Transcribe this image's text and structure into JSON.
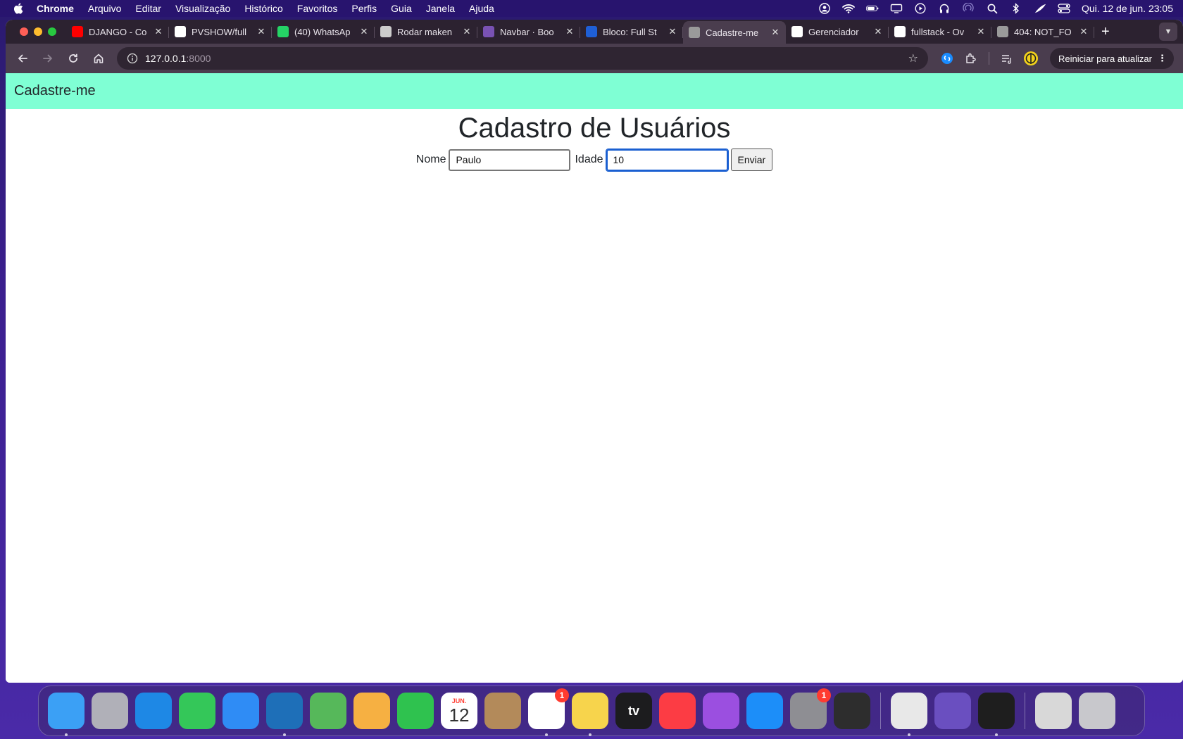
{
  "menubar": {
    "app_name": "Chrome",
    "items": [
      "Arquivo",
      "Editar",
      "Visualização",
      "Histórico",
      "Favoritos",
      "Perfis",
      "Guia",
      "Janela",
      "Ajuda"
    ],
    "clock": "Qui. 12 de jun.  23:05"
  },
  "tabs": [
    {
      "title": "DJANGO - Co",
      "icon": "youtube-icon",
      "color": "#ff0000"
    },
    {
      "title": "PVSHOW/full",
      "icon": "github-icon",
      "color": "#ffffff"
    },
    {
      "title": "(40) WhatsAp",
      "icon": "whatsapp-icon",
      "color": "#25d366"
    },
    {
      "title": "Rodar maken",
      "icon": "openai-icon",
      "color": "#cccccc"
    },
    {
      "title": "Navbar · Boo",
      "icon": "bootstrap-icon",
      "color": "#7952b3"
    },
    {
      "title": "Bloco: Full St",
      "icon": "bloco-icon",
      "color": "#1f5fd6"
    },
    {
      "title": "Cadastre-me",
      "icon": "globe-icon",
      "color": "#9a9a9a",
      "active": true
    },
    {
      "title": "Gerenciador",
      "icon": "password-manager-icon",
      "color": "#ffffff"
    },
    {
      "title": "fullstack - Ov",
      "icon": "vercel-icon",
      "color": "#ffffff"
    },
    {
      "title": "404: NOT_FO",
      "icon": "globe-icon",
      "color": "#9a9a9a"
    }
  ],
  "toolbar": {
    "url_host": "127.0.0.1",
    "url_port": ":8000",
    "update_label": "Reiniciar para atualizar"
  },
  "page": {
    "brand": "Cadastre-me",
    "navbar_color": "#7fffd4",
    "title": "Cadastro de Usuários",
    "form": {
      "name_label": "Nome",
      "name_value": "Paulo",
      "age_label": "Idade",
      "age_value": "10",
      "submit_label": "Enviar"
    }
  },
  "dock": {
    "apps": [
      {
        "name": "finder",
        "color": "#3ba0f5",
        "running": true
      },
      {
        "name": "launchpad",
        "color": "#b0b0b8"
      },
      {
        "name": "safari",
        "color": "#1e88e5"
      },
      {
        "name": "messages",
        "color": "#34c759"
      },
      {
        "name": "mail",
        "color": "#2f8cf5"
      },
      {
        "name": "vscode",
        "color": "#1e6fb8",
        "running": true
      },
      {
        "name": "maps",
        "color": "#56b85a"
      },
      {
        "name": "photos",
        "color": "#f6b042"
      },
      {
        "name": "facetime",
        "color": "#2fc24f"
      },
      {
        "name": "calendar",
        "color": "#ffffff",
        "label_month": "JUN.",
        "label_day": "12"
      },
      {
        "name": "contacts",
        "color": "#b38a5a"
      },
      {
        "name": "reminders",
        "color": "#ffffff",
        "badge": "1",
        "running": true
      },
      {
        "name": "notes",
        "color": "#f7d44c",
        "running": true
      },
      {
        "name": "tv",
        "color": "#1c1c1e",
        "label": "tv"
      },
      {
        "name": "music",
        "color": "#fc3c44"
      },
      {
        "name": "podcasts",
        "color": "#9b4fe0"
      },
      {
        "name": "app-store",
        "color": "#1c8ef9"
      },
      {
        "name": "system-settings",
        "color": "#8e8e93",
        "badge": "1"
      },
      {
        "name": "dbeaver",
        "color": "#2d2d2d"
      },
      {
        "name": "chrome",
        "color": "#e8e8e8",
        "running": true,
        "sep_before": true
      },
      {
        "name": "quill",
        "color": "#6a4fc0"
      },
      {
        "name": "terminal",
        "color": "#1e1e1e",
        "running": true
      },
      {
        "name": "documents",
        "color": "#d8d8d8",
        "sep_before": true
      },
      {
        "name": "trash",
        "color": "#c8c8cc"
      }
    ]
  }
}
